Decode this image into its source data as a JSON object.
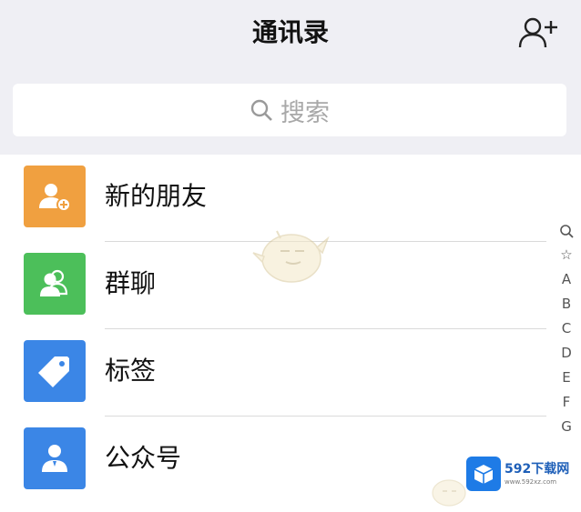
{
  "header": {
    "title": "通讯录"
  },
  "search": {
    "placeholder": "搜索"
  },
  "contacts_menu": [
    {
      "label": "新的朋友",
      "icon": "new-friend-icon",
      "color": "#f0a040"
    },
    {
      "label": "群聊",
      "icon": "group-chat-icon",
      "color": "#4cbf5a"
    },
    {
      "label": "标签",
      "icon": "tag-icon",
      "color": "#3b86e6"
    },
    {
      "label": "公众号",
      "icon": "official-account-icon",
      "color": "#3b86e6"
    }
  ],
  "index_bar": {
    "items": [
      "☆",
      "A",
      "B",
      "C",
      "D",
      "E",
      "F",
      "G"
    ]
  },
  "watermark": {
    "brand": "592下载网",
    "url": "www.592xz.com"
  },
  "colors": {
    "background": "#efeff4",
    "list_background": "#ffffff",
    "divider": "#dadada"
  }
}
